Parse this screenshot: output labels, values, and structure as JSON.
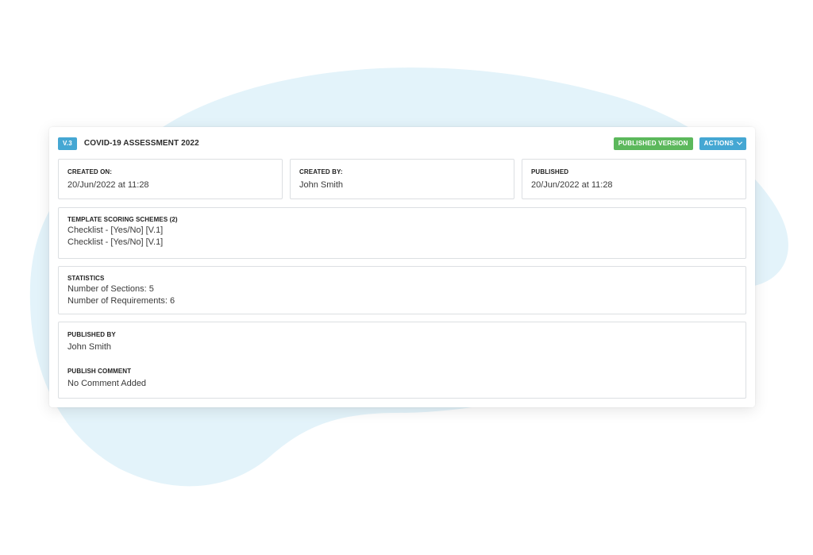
{
  "record": {
    "version": "V.3",
    "title": "COVID-19 ASSESSMENT 2022",
    "status": "PUBLISHED VERSION",
    "actions_label": "ACTIONS"
  },
  "meta": {
    "created_on": {
      "label": "CREATED ON:",
      "value": "20/Jun/2022 at 11:28"
    },
    "created_by": {
      "label": "CREATED BY:",
      "value": "John Smith"
    },
    "published": {
      "label": "PUBLISHED",
      "value": "20/Jun/2022 at 11:28"
    }
  },
  "scoring": {
    "label": "TEMPLATE SCORING SCHEMES (2)",
    "items": [
      "Checklist - [Yes/No] [V.1]",
      "Checklist - [Yes/No] [V.1]"
    ]
  },
  "statistics": {
    "label": "STATISTICS",
    "items": [
      "Number of Sections: 5",
      "Number of Requirements: 6"
    ]
  },
  "publish": {
    "by_label": "PUBLISHED BY",
    "by_value": "John Smith",
    "comment_label": "PUBLISH COMMENT",
    "comment_value": "No Comment Added"
  },
  "colors": {
    "accent": "#45a7d3",
    "success": "#5cb85c",
    "blob": "#e3f3fa"
  },
  "icons": {
    "actions_caret": "chevron-down-icon"
  }
}
